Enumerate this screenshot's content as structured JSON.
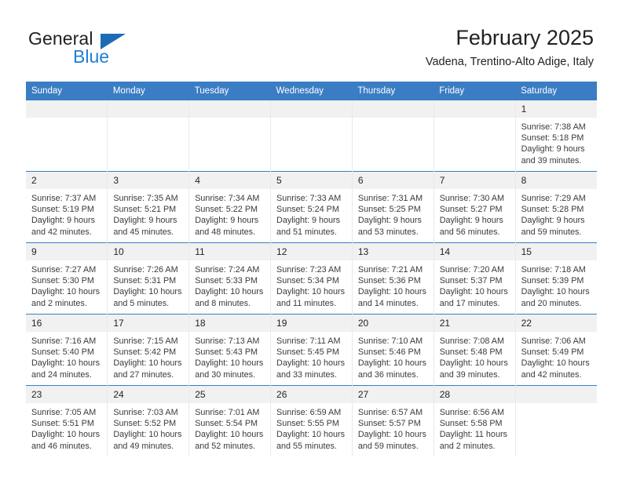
{
  "brand": {
    "name_part1": "General",
    "name_part2": "Blue",
    "triangle_color": "#1c6cb5",
    "blue_color": "#1c7fd6"
  },
  "header": {
    "title": "February 2025",
    "subtitle": "Vadena, Trentino-Alto Adige, Italy",
    "header_bg_color": "#3b7dc4",
    "daynum_bg_color": "#f1f1f1"
  },
  "weekdays": [
    "Sunday",
    "Monday",
    "Tuesday",
    "Wednesday",
    "Thursday",
    "Friday",
    "Saturday"
  ],
  "weeks": [
    [
      {
        "day": "",
        "sunrise": "",
        "sunset": "",
        "daylight": "",
        "empty": true
      },
      {
        "day": "",
        "sunrise": "",
        "sunset": "",
        "daylight": "",
        "empty": true
      },
      {
        "day": "",
        "sunrise": "",
        "sunset": "",
        "daylight": "",
        "empty": true
      },
      {
        "day": "",
        "sunrise": "",
        "sunset": "",
        "daylight": "",
        "empty": true
      },
      {
        "day": "",
        "sunrise": "",
        "sunset": "",
        "daylight": "",
        "empty": true
      },
      {
        "day": "",
        "sunrise": "",
        "sunset": "",
        "daylight": "",
        "empty": true
      },
      {
        "day": "1",
        "sunrise": "Sunrise: 7:38 AM",
        "sunset": "Sunset: 5:18 PM",
        "daylight": "Daylight: 9 hours and 39 minutes.",
        "empty": false
      }
    ],
    [
      {
        "day": "2",
        "sunrise": "Sunrise: 7:37 AM",
        "sunset": "Sunset: 5:19 PM",
        "daylight": "Daylight: 9 hours and 42 minutes.",
        "empty": false
      },
      {
        "day": "3",
        "sunrise": "Sunrise: 7:35 AM",
        "sunset": "Sunset: 5:21 PM",
        "daylight": "Daylight: 9 hours and 45 minutes.",
        "empty": false
      },
      {
        "day": "4",
        "sunrise": "Sunrise: 7:34 AM",
        "sunset": "Sunset: 5:22 PM",
        "daylight": "Daylight: 9 hours and 48 minutes.",
        "empty": false
      },
      {
        "day": "5",
        "sunrise": "Sunrise: 7:33 AM",
        "sunset": "Sunset: 5:24 PM",
        "daylight": "Daylight: 9 hours and 51 minutes.",
        "empty": false
      },
      {
        "day": "6",
        "sunrise": "Sunrise: 7:31 AM",
        "sunset": "Sunset: 5:25 PM",
        "daylight": "Daylight: 9 hours and 53 minutes.",
        "empty": false
      },
      {
        "day": "7",
        "sunrise": "Sunrise: 7:30 AM",
        "sunset": "Sunset: 5:27 PM",
        "daylight": "Daylight: 9 hours and 56 minutes.",
        "empty": false
      },
      {
        "day": "8",
        "sunrise": "Sunrise: 7:29 AM",
        "sunset": "Sunset: 5:28 PM",
        "daylight": "Daylight: 9 hours and 59 minutes.",
        "empty": false
      }
    ],
    [
      {
        "day": "9",
        "sunrise": "Sunrise: 7:27 AM",
        "sunset": "Sunset: 5:30 PM",
        "daylight": "Daylight: 10 hours and 2 minutes.",
        "empty": false
      },
      {
        "day": "10",
        "sunrise": "Sunrise: 7:26 AM",
        "sunset": "Sunset: 5:31 PM",
        "daylight": "Daylight: 10 hours and 5 minutes.",
        "empty": false
      },
      {
        "day": "11",
        "sunrise": "Sunrise: 7:24 AM",
        "sunset": "Sunset: 5:33 PM",
        "daylight": "Daylight: 10 hours and 8 minutes.",
        "empty": false
      },
      {
        "day": "12",
        "sunrise": "Sunrise: 7:23 AM",
        "sunset": "Sunset: 5:34 PM",
        "daylight": "Daylight: 10 hours and 11 minutes.",
        "empty": false
      },
      {
        "day": "13",
        "sunrise": "Sunrise: 7:21 AM",
        "sunset": "Sunset: 5:36 PM",
        "daylight": "Daylight: 10 hours and 14 minutes.",
        "empty": false
      },
      {
        "day": "14",
        "sunrise": "Sunrise: 7:20 AM",
        "sunset": "Sunset: 5:37 PM",
        "daylight": "Daylight: 10 hours and 17 minutes.",
        "empty": false
      },
      {
        "day": "15",
        "sunrise": "Sunrise: 7:18 AM",
        "sunset": "Sunset: 5:39 PM",
        "daylight": "Daylight: 10 hours and 20 minutes.",
        "empty": false
      }
    ],
    [
      {
        "day": "16",
        "sunrise": "Sunrise: 7:16 AM",
        "sunset": "Sunset: 5:40 PM",
        "daylight": "Daylight: 10 hours and 24 minutes.",
        "empty": false
      },
      {
        "day": "17",
        "sunrise": "Sunrise: 7:15 AM",
        "sunset": "Sunset: 5:42 PM",
        "daylight": "Daylight: 10 hours and 27 minutes.",
        "empty": false
      },
      {
        "day": "18",
        "sunrise": "Sunrise: 7:13 AM",
        "sunset": "Sunset: 5:43 PM",
        "daylight": "Daylight: 10 hours and 30 minutes.",
        "empty": false
      },
      {
        "day": "19",
        "sunrise": "Sunrise: 7:11 AM",
        "sunset": "Sunset: 5:45 PM",
        "daylight": "Daylight: 10 hours and 33 minutes.",
        "empty": false
      },
      {
        "day": "20",
        "sunrise": "Sunrise: 7:10 AM",
        "sunset": "Sunset: 5:46 PM",
        "daylight": "Daylight: 10 hours and 36 minutes.",
        "empty": false
      },
      {
        "day": "21",
        "sunrise": "Sunrise: 7:08 AM",
        "sunset": "Sunset: 5:48 PM",
        "daylight": "Daylight: 10 hours and 39 minutes.",
        "empty": false
      },
      {
        "day": "22",
        "sunrise": "Sunrise: 7:06 AM",
        "sunset": "Sunset: 5:49 PM",
        "daylight": "Daylight: 10 hours and 42 minutes.",
        "empty": false
      }
    ],
    [
      {
        "day": "23",
        "sunrise": "Sunrise: 7:05 AM",
        "sunset": "Sunset: 5:51 PM",
        "daylight": "Daylight: 10 hours and 46 minutes.",
        "empty": false
      },
      {
        "day": "24",
        "sunrise": "Sunrise: 7:03 AM",
        "sunset": "Sunset: 5:52 PM",
        "daylight": "Daylight: 10 hours and 49 minutes.",
        "empty": false
      },
      {
        "day": "25",
        "sunrise": "Sunrise: 7:01 AM",
        "sunset": "Sunset: 5:54 PM",
        "daylight": "Daylight: 10 hours and 52 minutes.",
        "empty": false
      },
      {
        "day": "26",
        "sunrise": "Sunrise: 6:59 AM",
        "sunset": "Sunset: 5:55 PM",
        "daylight": "Daylight: 10 hours and 55 minutes.",
        "empty": false
      },
      {
        "day": "27",
        "sunrise": "Sunrise: 6:57 AM",
        "sunset": "Sunset: 5:57 PM",
        "daylight": "Daylight: 10 hours and 59 minutes.",
        "empty": false
      },
      {
        "day": "28",
        "sunrise": "Sunrise: 6:56 AM",
        "sunset": "Sunset: 5:58 PM",
        "daylight": "Daylight: 11 hours and 2 minutes.",
        "empty": false
      },
      {
        "day": "",
        "sunrise": "",
        "sunset": "",
        "daylight": "",
        "empty": true
      }
    ]
  ]
}
